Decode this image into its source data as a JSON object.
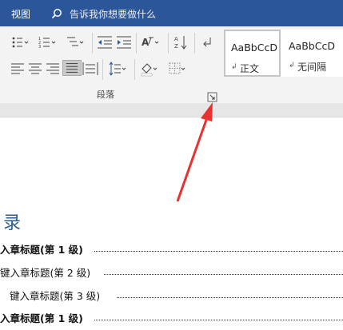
{
  "header": {
    "tab_view": "视图",
    "tell_me": "告诉我你想要做什么"
  },
  "paragraph_group": {
    "label": "段落",
    "icons": [
      "bullets-icon",
      "numbering-icon",
      "multilevel-list-icon",
      "decrease-indent-icon",
      "increase-indent-icon",
      "chinese-layout-icon",
      "sort-icon",
      "show-marks-icon",
      "align-left-icon",
      "align-center-icon",
      "align-right-icon",
      "justify-icon",
      "distributed-icon",
      "line-spacing-icon",
      "shading-icon",
      "borders-icon",
      "dialog-launcher-icon"
    ]
  },
  "styles": {
    "items": [
      {
        "sample": "AaBbCcD",
        "name": "正文"
      },
      {
        "sample": "AaBbCcD",
        "name": "无间隔"
      }
    ]
  },
  "document": {
    "toc_title": "录",
    "entries": [
      {
        "text": "入章标题(第 1 级)",
        "level": 1
      },
      {
        "text": "键入章标题(第 2 级)",
        "level": 2
      },
      {
        "text": "键入章标题(第 3 级)",
        "level": 3
      },
      {
        "text": "入章标题(第 1 级)",
        "level": 1
      }
    ]
  },
  "annotation": {
    "color": "#e8322f"
  }
}
